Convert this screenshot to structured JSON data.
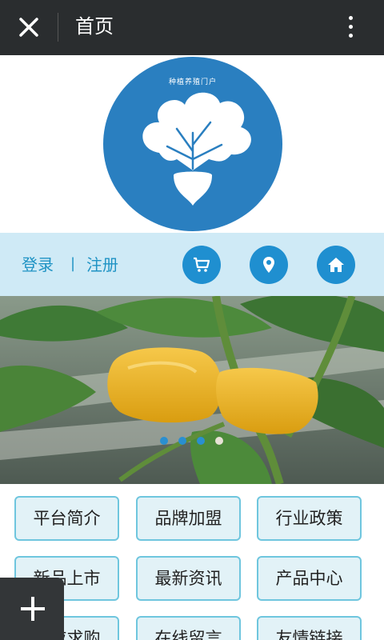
{
  "topbar": {
    "title": "首页",
    "close_icon": "close-icon",
    "more_icon": "more-vertical-icon"
  },
  "logo": {
    "text": "种植养殖门户",
    "color": "#2a7fc0"
  },
  "account": {
    "login": "登录",
    "separator": "|",
    "register": "注册"
  },
  "actions": [
    {
      "name": "cart-icon"
    },
    {
      "name": "location-pin-icon"
    },
    {
      "name": "home-icon"
    }
  ],
  "banner": {
    "dots_total": 4,
    "active_dot": 4
  },
  "categories": [
    {
      "label": "平台简介"
    },
    {
      "label": "品牌加盟"
    },
    {
      "label": "行业政策"
    },
    {
      "label": "新品上市"
    },
    {
      "label": "最新资讯"
    },
    {
      "label": "产品中心"
    },
    {
      "label": "供应求购"
    },
    {
      "label": "在线留言"
    },
    {
      "label": "友情链接"
    }
  ],
  "fab": {
    "icon": "plus-icon"
  },
  "colors": {
    "topbar": "#2a2d2f",
    "accent": "#1f8fd0",
    "bar": "#cfeaf6",
    "button_border": "#6fc6de"
  }
}
